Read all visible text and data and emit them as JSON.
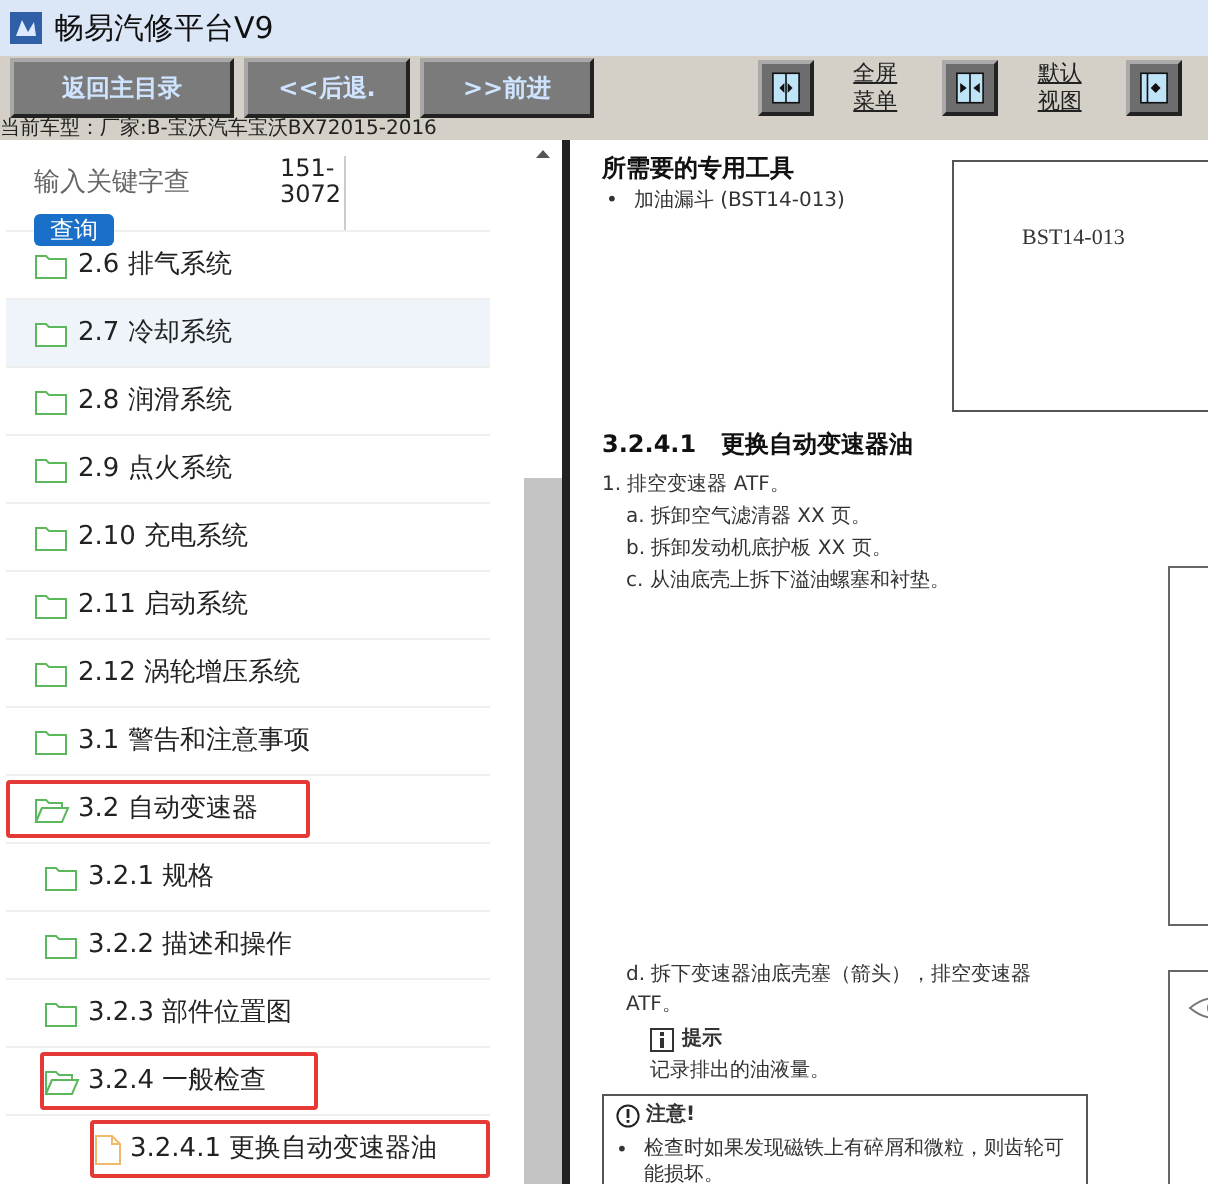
{
  "window": {
    "title": "畅易汽修平台V9"
  },
  "toolbar": {
    "buttons": [
      "返回主目录",
      "<<后退.",
      ">>前进"
    ],
    "view_controls": [
      {
        "kind": "icon-button"
      },
      {
        "kind": "link",
        "label": "全屏菜单"
      },
      {
        "kind": "icon-button"
      },
      {
        "kind": "link",
        "label": "默认视图"
      },
      {
        "kind": "icon-button"
      }
    ]
  },
  "car_model": "当前车型：厂家:B-宝沃汽车宝沃BX72015-2016",
  "search": {
    "placeholder": "输入关键字查",
    "button": "查询",
    "code": "151-3072"
  },
  "tree": [
    {
      "kind": "folder",
      "label": "2.6 排气系统",
      "expanded": false,
      "hovered": false,
      "highlighted": false
    },
    {
      "kind": "folder",
      "label": "2.7 冷却系统",
      "expanded": false,
      "hovered": true,
      "highlighted": false
    },
    {
      "kind": "folder",
      "label": "2.8 润滑系统",
      "expanded": false,
      "hovered": false,
      "highlighted": false
    },
    {
      "kind": "folder",
      "label": "2.9 点火系统",
      "expanded": false,
      "hovered": false,
      "highlighted": false
    },
    {
      "kind": "folder",
      "label": "2.10 充电系统",
      "expanded": false,
      "hovered": false,
      "highlighted": false
    },
    {
      "kind": "folder",
      "label": "2.11 启动系统",
      "expanded": false,
      "hovered": false,
      "highlighted": false
    },
    {
      "kind": "folder",
      "label": "2.12 涡轮增压系统",
      "expanded": false,
      "hovered": false,
      "highlighted": false
    },
    {
      "kind": "folder",
      "label": "3.1 警告和注意事项",
      "expanded": false,
      "hovered": false,
      "highlighted": false
    },
    {
      "kind": "folder",
      "label": "3.2 自动变速器",
      "expanded": true,
      "hovered": false,
      "highlighted": true,
      "children": [
        {
          "kind": "folder",
          "label": "3.2.1 规格",
          "expanded": false,
          "hovered": false,
          "highlighted": false
        },
        {
          "kind": "folder",
          "label": "3.2.2 描述和操作",
          "expanded": false,
          "hovered": false,
          "highlighted": false
        },
        {
          "kind": "folder",
          "label": "3.2.3 部件位置图",
          "expanded": false,
          "hovered": false,
          "highlighted": false
        },
        {
          "kind": "folder",
          "label": "3.2.4 一般检查",
          "expanded": true,
          "hovered": false,
          "highlighted": true,
          "children": [
            {
              "kind": "file",
              "label": "3.2.4.1 更换自动变速器油",
              "hovered": false,
              "highlighted": true
            }
          ]
        }
      ]
    }
  ],
  "document": {
    "tools_heading": "所需要的专用工具",
    "tools": [
      {
        "marker": "•",
        "text": "加油漏斗 (BST14-013)"
      }
    ],
    "tool_figure_label": "BST14-013",
    "section_heading": "3.2.4.1   更换自动变速器油",
    "steps": [
      {
        "text": "1. 排空变速器 ATF。",
        "substeps": [
          "a. 拆卸空气滤清器 XX 页。",
          "b. 拆卸发动机底护板 XX 页。",
          "c. 从油底壳上拆下溢油螺塞和衬垫。"
        ]
      }
    ],
    "step_d": "d. 拆下变速器油底壳塞（箭头），排空变速器 ATF。",
    "tip": {
      "title": "提示",
      "text": "记录排出的油液量。"
    },
    "caution": {
      "title": "注意!",
      "items": [
        {
          "marker": "•",
          "text": "检查时如果发现磁铁上有碎屑和微粒，则齿轮可能损坏。"
        }
      ]
    }
  }
}
